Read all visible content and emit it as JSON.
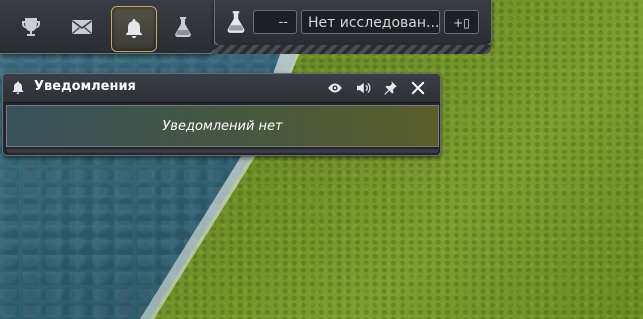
{
  "toolbar": {
    "buttons": [
      {
        "icon": "trophy-icon",
        "active": false
      },
      {
        "icon": "envelope-icon",
        "active": false
      },
      {
        "icon": "bell-icon",
        "active": true
      },
      {
        "icon": "flask-icon",
        "active": false
      }
    ]
  },
  "research": {
    "timer": "--",
    "topic": "Нет исследован...",
    "add_label": "+▯"
  },
  "notifications": {
    "title": "Уведомления",
    "empty_text": "Уведомлений нет"
  },
  "colors": {
    "panel_bg": "#2a2c33",
    "active_border": "#c8a962",
    "text": "#ffffff"
  }
}
